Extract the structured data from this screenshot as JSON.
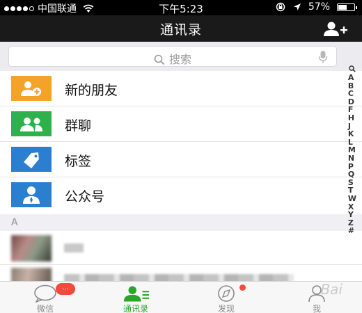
{
  "status_bar": {
    "carrier": "中国联通",
    "time": "下午5:23",
    "battery": "57%",
    "battery_level": 0.57
  },
  "nav": {
    "title": "通讯录"
  },
  "search": {
    "placeholder": "搜索"
  },
  "function_items": [
    {
      "label": "新的朋友",
      "icon": "new-friends-icon",
      "color": "#f5a229"
    },
    {
      "label": "群聊",
      "icon": "group-chat-icon",
      "color": "#2eb04a"
    },
    {
      "label": "标签",
      "icon": "tag-icon",
      "color": "#2a7fd1"
    },
    {
      "label": "公众号",
      "icon": "official-account-icon",
      "color": "#2a7fd1"
    }
  ],
  "section": {
    "letter": "A"
  },
  "index_letters": [
    "A",
    "B",
    "C",
    "D",
    "F",
    "H",
    "J",
    "K",
    "L",
    "M",
    "N",
    "P",
    "Q",
    "S",
    "T",
    "W",
    "X",
    "Y",
    "Z",
    "#"
  ],
  "tabs": [
    {
      "label": "微信",
      "icon": "chat-bubble-icon",
      "active": false,
      "badge": "..."
    },
    {
      "label": "通讯录",
      "icon": "contacts-icon",
      "active": true
    },
    {
      "label": "发现",
      "icon": "discover-icon",
      "active": false
    },
    {
      "label": "我",
      "icon": "me-icon",
      "active": false
    }
  ],
  "colors": {
    "accent": "#2aa52a",
    "badge": "#f24a3d",
    "nav_bg": "#1a1a1a"
  },
  "watermark": "Bai"
}
